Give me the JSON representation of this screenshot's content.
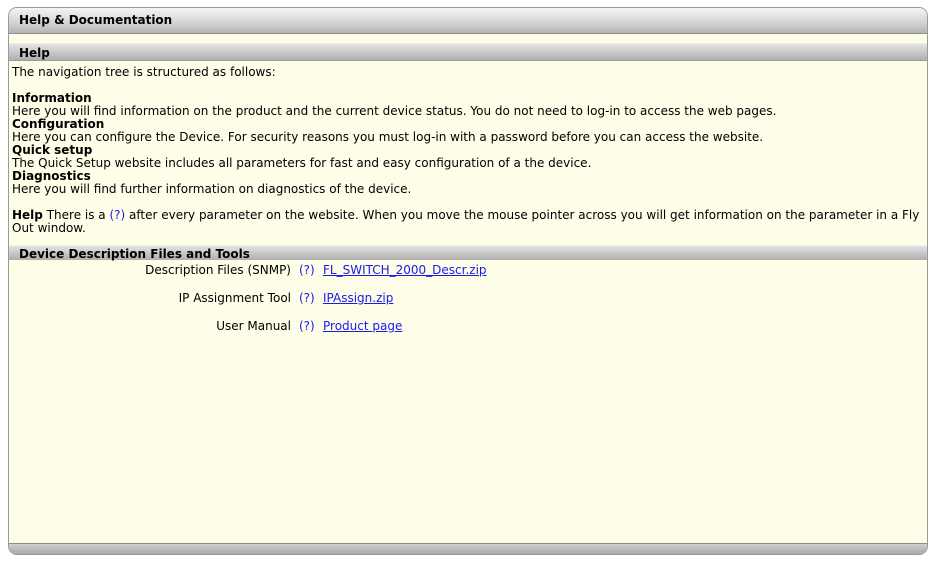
{
  "panel": {
    "title": "Help & Documentation"
  },
  "help": {
    "header": "Help",
    "intro": "The navigation tree is structured as follows:",
    "items": [
      {
        "term": "Information",
        "description": "Here you will find information on the product and the current device status. You do not need to log-in to access the web pages."
      },
      {
        "term": "Configuration",
        "description": "Here you can configure the Device. For security reasons you must log-in with a password before you can access the website."
      },
      {
        "term": "Quick setup",
        "description": "The Quick Setup website includes all parameters for fast and easy configuration of a the device."
      },
      {
        "term": "Diagnostics",
        "description": "Here you will find further information on diagnostics of the device."
      }
    ],
    "note_term": "Help",
    "note_pre": " There is a ",
    "note_qmark": "(?)",
    "note_post": " after every parameter on the website. When you move the mouse pointer across you will get information on the parameter in a Fly Out window."
  },
  "device": {
    "header": "Device Description Files and Tools",
    "rows": [
      {
        "label": "Description Files (SNMP)",
        "qmark": "(?)",
        "link": "FL_SWITCH_2000_Descr.zip"
      },
      {
        "label": "IP Assignment Tool",
        "qmark": "(?)",
        "link": "IPAssign.zip"
      },
      {
        "label": "User Manual",
        "qmark": "(?)",
        "link": "Product page"
      }
    ]
  }
}
